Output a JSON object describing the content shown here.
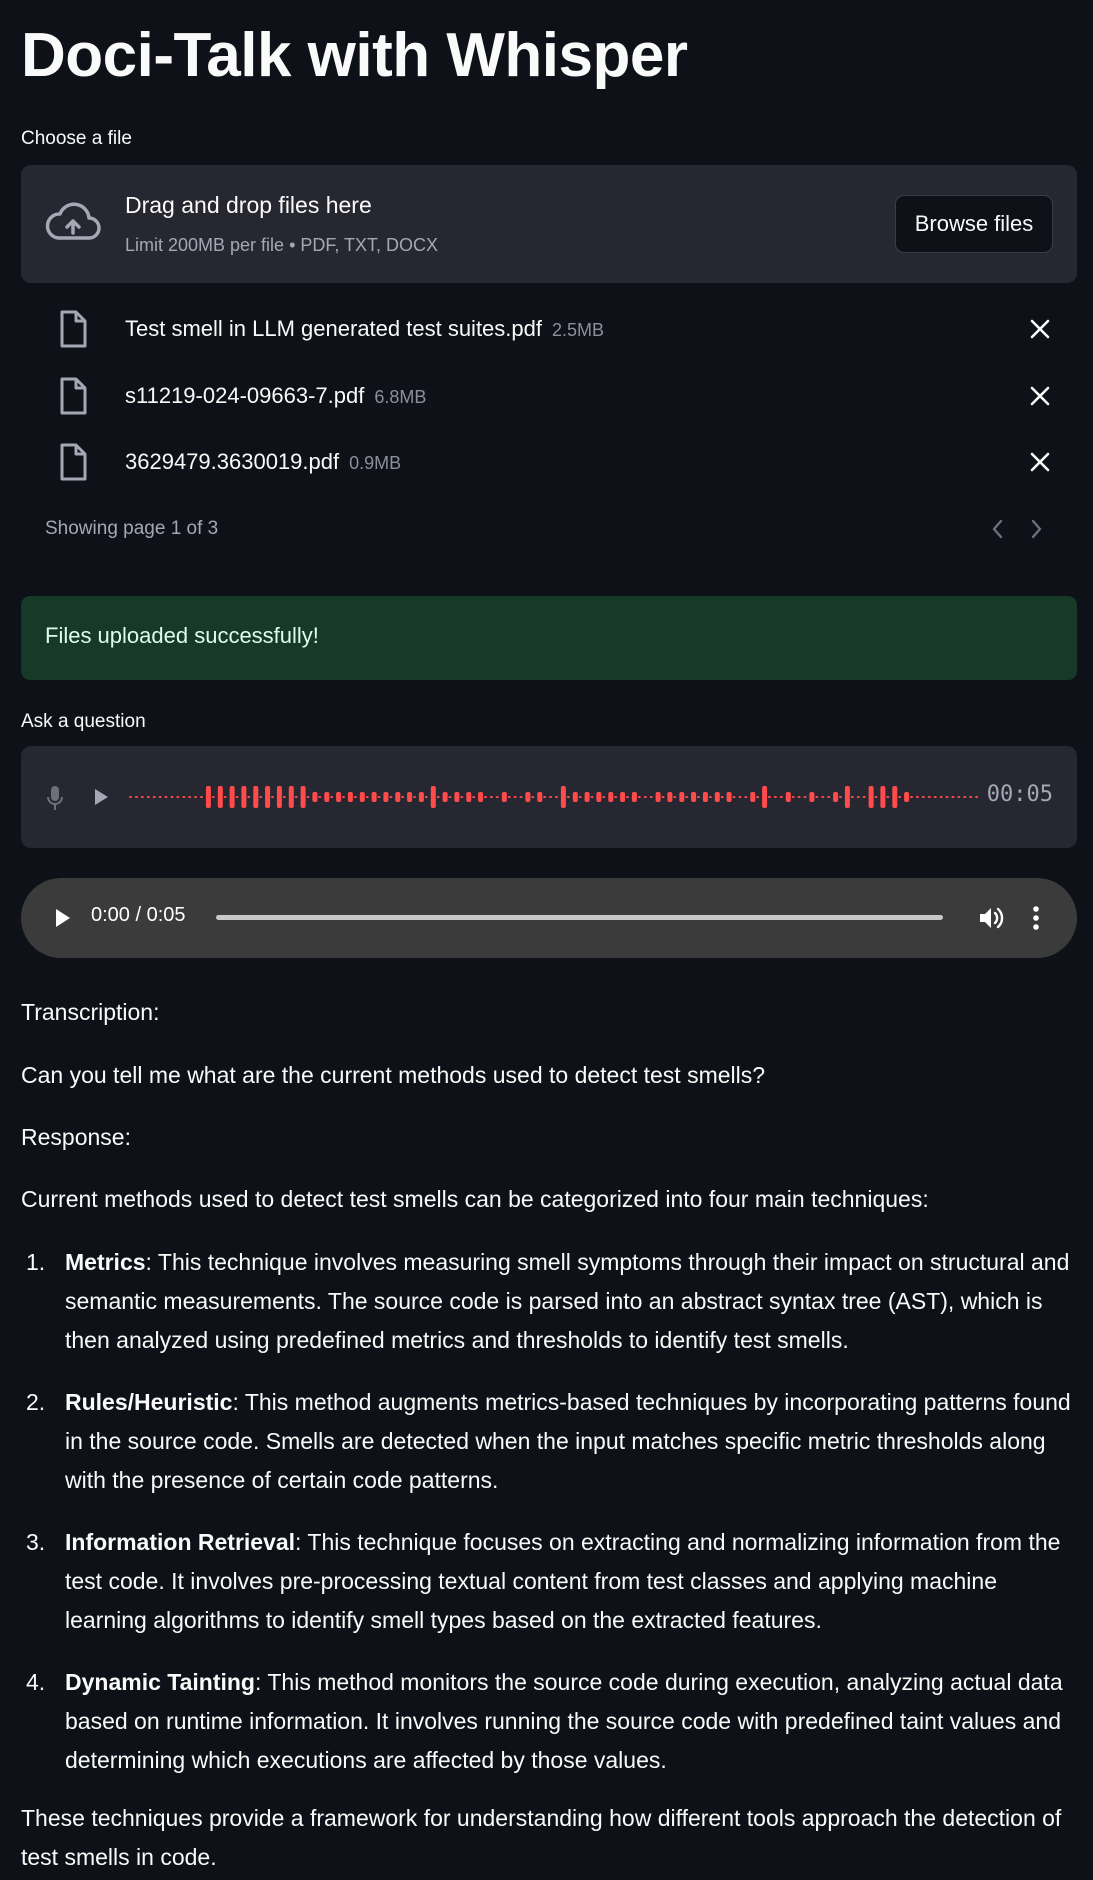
{
  "app": {
    "title": "Doci-Talk with Whisper"
  },
  "uploader": {
    "label": "Choose a file",
    "drop_title": "Drag and drop files here",
    "drop_limit": "Limit 200MB per file • PDF, TXT, DOCX",
    "browse_label": "Browse files",
    "files": [
      {
        "name": "Test smell in LLM generated test suites.pdf",
        "size": "2.5MB"
      },
      {
        "name": "s11219-024-09663-7.pdf",
        "size": "6.8MB"
      },
      {
        "name": "3629479.3630019.pdf",
        "size": "0.9MB"
      }
    ],
    "pager_text": "Showing page 1 of 3"
  },
  "status": {
    "success_message": "Files uploaded successfully!"
  },
  "recorder": {
    "label": "Ask a question",
    "duration": "00:05",
    "wave_color": "#ff4b4b"
  },
  "player": {
    "time": "0:00 / 0:05"
  },
  "transcription": {
    "label": "Transcription:",
    "text": "Can you tell me what are the current methods used to detect test smells?"
  },
  "response": {
    "label": "Response:",
    "intro": "Current methods used to detect test smells can be categorized into four main techniques:",
    "items": [
      {
        "num": "1.",
        "term": "Metrics",
        "desc": ": This technique involves measuring smell symptoms through their impact on structural and semantic measurements. The source code is parsed into an abstract syntax tree (AST), which is then analyzed using predefined metrics and thresholds to identify test smells."
      },
      {
        "num": "2.",
        "term": "Rules/Heuristic",
        "desc": ": This method augments metrics-based techniques by incorporating patterns found in the source code. Smells are detected when the input matches specific metric thresholds along with the presence of certain code patterns."
      },
      {
        "num": "3.",
        "term": "Information Retrieval",
        "desc": ": This technique focuses on extracting and normalizing information from the test code. It involves pre-processing textual content from test classes and applying machine learning algorithms to identify smell types based on the extracted features."
      },
      {
        "num": "4.",
        "term": "Dynamic Tainting",
        "desc": ": This method monitors the source code during execution, analyzing actual data based on runtime information. It involves running the source code with predefined taint values and determining which executions are affected by those values."
      }
    ],
    "conclusion": "These techniques provide a framework for understanding how different tools approach the detection of test smells in code."
  }
}
